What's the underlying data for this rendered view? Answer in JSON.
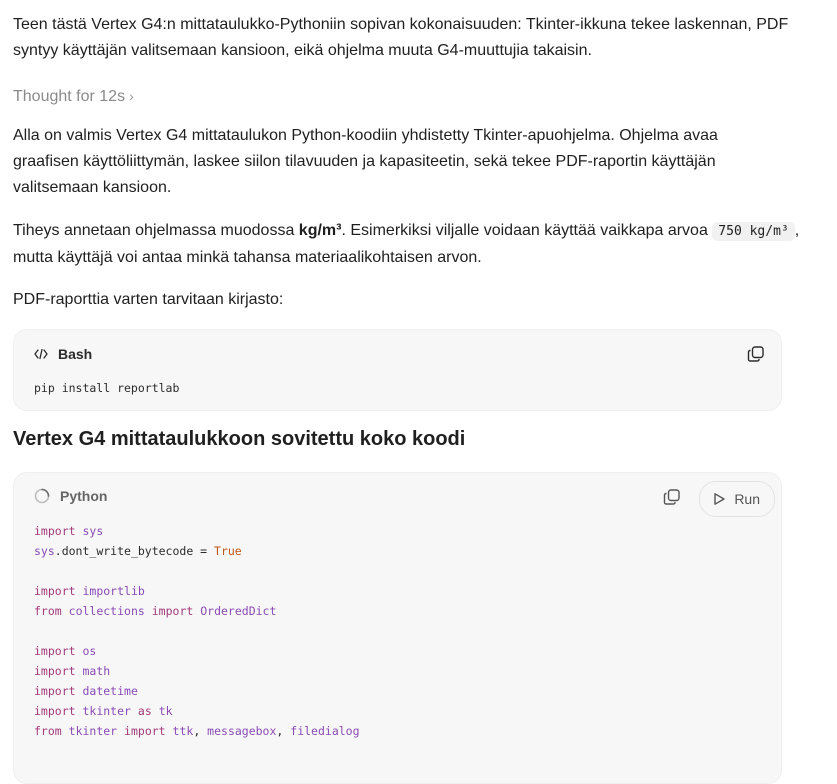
{
  "intro": {
    "line1": "Teen tästä Vertex G4:n mittataulukko-Pythoniin sopivan kokonaisuuden: Tkinter-ikkuna tekee laskennan, PDF",
    "line2": "syntyy käyttäjän valitsemaan kansioon, eikä ohjelma muuta G4-muuttujia takaisin."
  },
  "thought": {
    "label": "Thought for 12s",
    "chevron": "›"
  },
  "para1": {
    "line1": "Alla on valmis Vertex G4 mittataulukon Python-koodiin yhdistetty Tkinter-apuohjelma. Ohjelma avaa",
    "line2": "graafisen käyttöliittymän, laskee siilon tilavuuden ja kapasiteetin, sekä tekee PDF-raportin käyttäjän",
    "line3": "valitsemaan kansioon."
  },
  "para2": {
    "pre": "Tiheys annetaan ohjelmassa muodossa ",
    "bold": "kg/m³",
    "mid": ". Esimerkiksi viljalle voidaan käyttää vaikkapa arvoa ",
    "code": "750 kg/m³",
    "post": ",",
    "line2": "mutta käyttäjä voi antaa minkä tahansa materiaalikohtaisen arvon."
  },
  "para3": "PDF-raporttia varten tarvitaan kirjasto:",
  "bash_block": {
    "lang": "Bash",
    "icon": "code-icon",
    "copy_icon": "copy-icon",
    "code": "pip install reportlab"
  },
  "section_heading": "Vertex G4 mittataulukkoon sovitettu koko koodi",
  "python_block": {
    "lang": "Python",
    "icon": "loading-spinner-icon",
    "copy_icon": "copy-icon",
    "run_label": "Run",
    "run_icon": "play-icon",
    "lines": [
      "import sys",
      "sys.dont_write_bytecode = True",
      "",
      "import importlib",
      "from collections import OrderedDict",
      "",
      "import os",
      "import math",
      "import datetime",
      "import tkinter as tk",
      "from tkinter import ttk, messagebox, filedialog"
    ]
  },
  "colors": {
    "keyword": "#a23a7a",
    "module": "#8a4bb5",
    "literal_true": "#c2561a",
    "thought_gray": "#8a8a8a",
    "code_bg": "#f7f7f7"
  }
}
